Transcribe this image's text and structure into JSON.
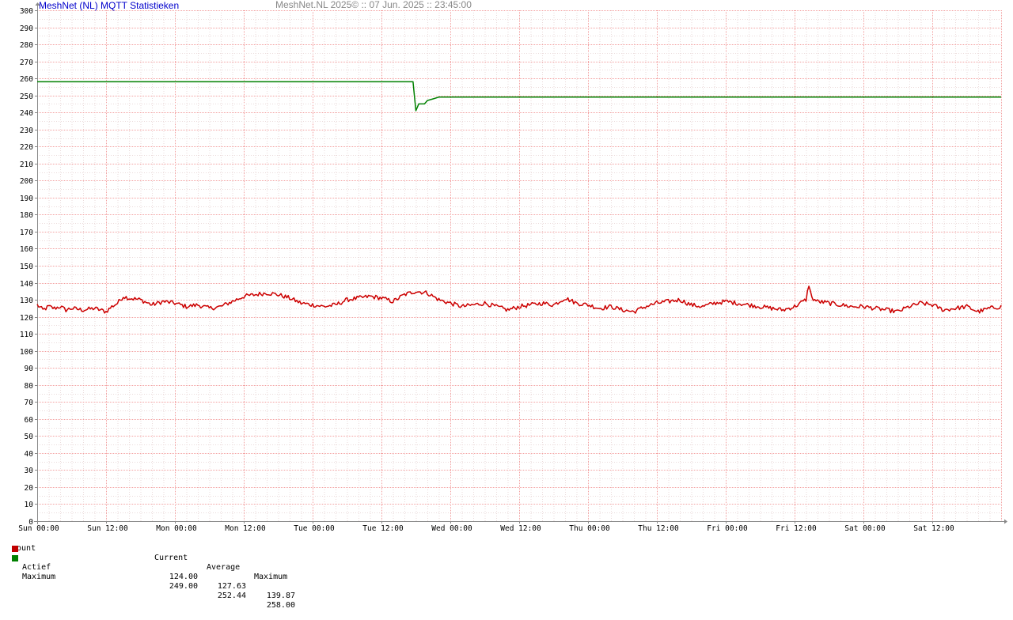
{
  "header": {
    "title": "MeshNet (NL) MQTT Statistieken",
    "stamp": "MeshNet.NL 2025© ::  07 Jun. 2025 :: 23:45:00"
  },
  "legend": {
    "unit": "count",
    "col_current": "Current",
    "col_average": "Average",
    "col_maximum": "Maximum",
    "rows": [
      {
        "name": "Actief",
        "color": "#c00000",
        "current": "124.00",
        "average": "127.63",
        "maximum": "139.87"
      },
      {
        "name": "Maximum",
        "color": "#008000",
        "current": "249.00",
        "average": "252.44",
        "maximum": "258.00"
      }
    ]
  },
  "chart_data": {
    "type": "line",
    "ylim": [
      0,
      300
    ],
    "yticks": [
      0,
      10,
      20,
      30,
      40,
      50,
      60,
      70,
      80,
      90,
      100,
      110,
      120,
      130,
      140,
      150,
      160,
      170,
      180,
      190,
      200,
      210,
      220,
      230,
      240,
      250,
      260,
      270,
      280,
      290,
      300
    ],
    "x_tick_labels": [
      "Sun 00:00",
      "Sun 12:00",
      "Mon 00:00",
      "Mon 12:00",
      "Tue 00:00",
      "Tue 12:00",
      "Wed 00:00",
      "Wed 12:00",
      "Thu 00:00",
      "Thu 12:00",
      "Fri 00:00",
      "Fri 12:00",
      "Sat 00:00",
      "Sat 12:00"
    ],
    "xlim_hours": [
      0,
      168
    ],
    "grid": true,
    "series": [
      {
        "name": "Actief",
        "color": "#cc0000",
        "x_hours": [
          0,
          1,
          2,
          3,
          4,
          5,
          6,
          8,
          10,
          12,
          13,
          14,
          15,
          16,
          18,
          20,
          22,
          24,
          26,
          28,
          30,
          32,
          34,
          36,
          38,
          40,
          42,
          44,
          46,
          48,
          50,
          52,
          54,
          56,
          58,
          60,
          62,
          64,
          66,
          68,
          70,
          72,
          74,
          76,
          78,
          80,
          82,
          84,
          86,
          88,
          90,
          92,
          94,
          96,
          98,
          100,
          102,
          104,
          106,
          108,
          110,
          112,
          114,
          116,
          118,
          120,
          122,
          124,
          126,
          128,
          130,
          132,
          134,
          134.5,
          135,
          136,
          138,
          140,
          142,
          144,
          146,
          148,
          150,
          152,
          154,
          156,
          158,
          160,
          162,
          164,
          166,
          168
        ],
        "values": [
          127,
          124,
          126,
          125,
          126,
          124,
          125,
          124,
          125,
          123,
          126,
          128,
          132,
          131,
          130,
          127,
          129,
          128,
          126,
          127,
          125,
          126,
          129,
          132,
          133,
          134,
          133,
          131,
          128,
          127,
          126,
          127,
          130,
          131,
          132,
          131,
          129,
          133,
          135,
          134,
          130,
          128,
          126,
          127,
          128,
          126,
          124,
          126,
          127,
          128,
          127,
          131,
          128,
          127,
          125,
          126,
          124,
          123,
          126,
          128,
          129,
          130,
          127,
          126,
          128,
          129,
          128,
          127,
          126,
          125,
          124,
          126,
          130,
          139,
          131,
          129,
          128,
          127,
          126,
          126,
          125,
          124,
          123,
          126,
          128,
          127,
          124,
          125,
          126,
          123,
          125,
          126
        ]
      },
      {
        "name": "Maximum",
        "color": "#008000",
        "x_hours": [
          0,
          65.5,
          65.8,
          66,
          66.5,
          67.5,
          68,
          69,
          70,
          168
        ],
        "values": [
          258,
          258,
          248,
          241,
          245,
          245,
          247,
          248,
          249,
          249
        ]
      }
    ]
  }
}
